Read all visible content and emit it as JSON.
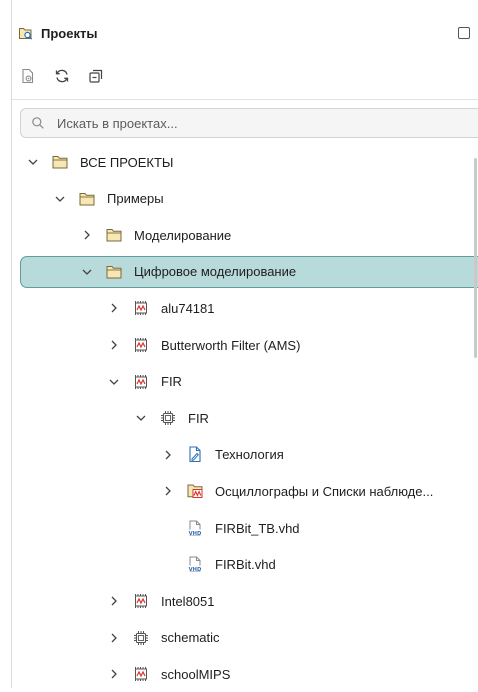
{
  "panel": {
    "title": "Проекты"
  },
  "search": {
    "placeholder": "Искать в проектах..."
  },
  "tree": [
    {
      "label": "ВСЕ ПРОЕКТЫ",
      "depth": 0,
      "expanded": true,
      "icon": "folder-icon"
    },
    {
      "label": "Примеры",
      "depth": 1,
      "expanded": true,
      "icon": "folder-icon"
    },
    {
      "label": "Моделирование",
      "depth": 2,
      "expanded": false,
      "icon": "folder-icon"
    },
    {
      "label": "Цифровое моделирование",
      "depth": 2,
      "expanded": true,
      "icon": "folder-icon",
      "selected": true
    },
    {
      "label": "alu74181",
      "depth": 3,
      "expanded": false,
      "icon": "waveform-chip-icon"
    },
    {
      "label": "Butterworth Filter  (AMS)",
      "depth": 3,
      "expanded": false,
      "icon": "waveform-chip-icon"
    },
    {
      "label": "FIR",
      "depth": 3,
      "expanded": true,
      "icon": "waveform-chip-icon"
    },
    {
      "label": "FIR",
      "depth": 4,
      "expanded": true,
      "icon": "chip-icon"
    },
    {
      "label": "Технология",
      "depth": 5,
      "expanded": false,
      "icon": "document-icon"
    },
    {
      "label": "Осциллографы и Списки наблюде...",
      "depth": 5,
      "expanded": false,
      "icon": "waveform-folder-icon"
    },
    {
      "label": "FIRBit_TB.vhd",
      "depth": 5,
      "leaf": true,
      "icon": "vhd-file-icon"
    },
    {
      "label": "FIRBit.vhd",
      "depth": 5,
      "leaf": true,
      "icon": "vhd-file-icon"
    },
    {
      "label": "Intel8051",
      "depth": 3,
      "expanded": false,
      "icon": "waveform-chip-icon"
    },
    {
      "label": "schematic",
      "depth": 3,
      "expanded": false,
      "icon": "chip-icon"
    },
    {
      "label": "schoolMIPS",
      "depth": 3,
      "expanded": false,
      "icon": "waveform-chip-icon"
    }
  ],
  "colors": {
    "accent": "#5f9e9e",
    "selected_bg": "#b9dada",
    "folder_fill": "#f7e7b4",
    "folder_stroke": "#7a6a3a",
    "wave_red": "#d9342b",
    "vhd_blue": "#2c6fb7"
  }
}
